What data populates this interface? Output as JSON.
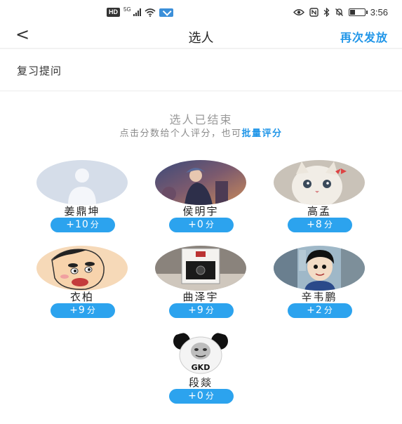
{
  "status_bar": {
    "hd_label": "HD",
    "network_label": "5G",
    "time": "3:56"
  },
  "navbar": {
    "back_glyph": "<",
    "title": "选人",
    "resend_label": "再次发放"
  },
  "question": {
    "label": "复习提问"
  },
  "result": {
    "ended_text": "选人已结束",
    "hint_prefix": "点击分数给个人评分，也可",
    "hint_link": "批量评分"
  },
  "score_unit": "分",
  "people": [
    {
      "name": "姜鼎坤",
      "score": "+10",
      "avatar": "default-user-avatar"
    },
    {
      "name": "侯明宇",
      "score": "+0",
      "avatar": "game-character-avatar"
    },
    {
      "name": "高孟",
      "score": "+8",
      "avatar": "kitten-avatar"
    },
    {
      "name": "衣柏",
      "score": "+9",
      "avatar": "cartoon-boy-avatar"
    },
    {
      "name": "曲泽宇",
      "score": "+9",
      "avatar": "watch-box-avatar"
    },
    {
      "name": "辛韦鹏",
      "score": "+2",
      "avatar": "anime-character-avatar"
    },
    {
      "name": "段燚",
      "score": "+0",
      "avatar": "panda-meme-avatar",
      "avatar_text": "GKD"
    }
  ]
}
